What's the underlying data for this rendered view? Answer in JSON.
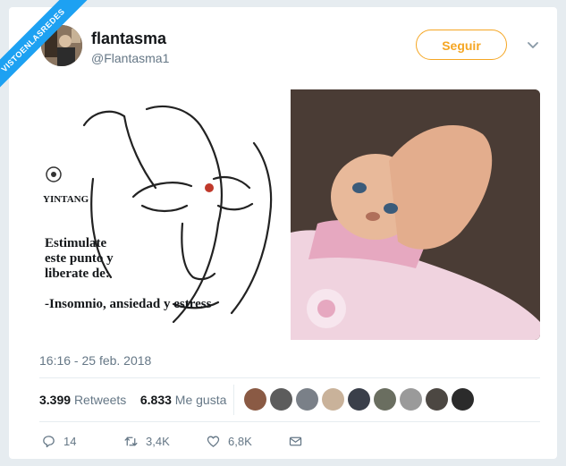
{
  "watermark": "VISTOENLASREDES",
  "user": {
    "display_name": "flantasma",
    "handle": "@Flantasma1"
  },
  "follow_label": "Seguir",
  "media": {
    "left_panel": {
      "label": "YINTANG",
      "text": "Estimulate\neste punto y\nliberate de:\n\n-Insomnio, ansiedad y estress"
    }
  },
  "timestamp": "16:16 - 25 feb. 2018",
  "stats": {
    "retweets_count": "3.399",
    "retweets_label": "Retweets",
    "likes_count": "6.833",
    "likes_label": "Me gusta"
  },
  "likers_count": 9,
  "actions": {
    "replies": "14",
    "retweets": "3,4K",
    "likes": "6,8K"
  },
  "colors": {
    "follow": "#f5a623",
    "ribbon": "#1da1f2",
    "muted": "#657786"
  },
  "icons": [
    "chevron-down-icon",
    "reply-icon",
    "retweet-icon",
    "like-icon",
    "message-icon"
  ]
}
